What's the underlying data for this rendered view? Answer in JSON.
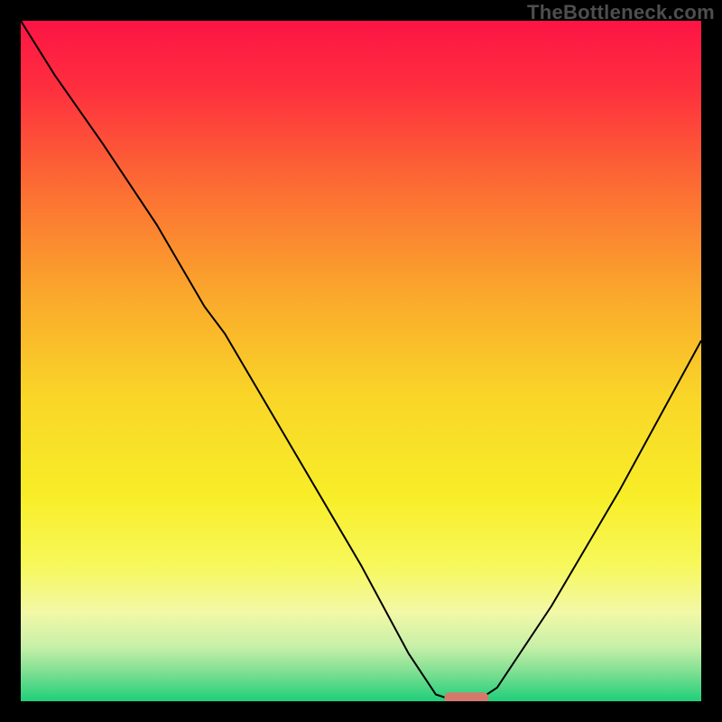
{
  "watermark": "TheBottleneck.com",
  "chart_data": {
    "type": "line",
    "title": "",
    "xlabel": "",
    "ylabel": "",
    "xlim": [
      0,
      100
    ],
    "ylim": [
      0,
      100
    ],
    "legend": false,
    "grid": false,
    "background": {
      "type": "vertical-gradient",
      "description": "Smooth vertical gradient from red at top through orange, yellow, pale yellow, pale green to green at bottom, representing severity (top=bad, bottom=good).",
      "stops": [
        {
          "pos": 0.0,
          "color": "#fd1445"
        },
        {
          "pos": 0.1,
          "color": "#fe2f3e"
        },
        {
          "pos": 0.25,
          "color": "#fc6f33"
        },
        {
          "pos": 0.4,
          "color": "#faa72c"
        },
        {
          "pos": 0.55,
          "color": "#f9d528"
        },
        {
          "pos": 0.7,
          "color": "#f8ee28"
        },
        {
          "pos": 0.8,
          "color": "#f7f85b"
        },
        {
          "pos": 0.87,
          "color": "#f2f8a7"
        },
        {
          "pos": 0.92,
          "color": "#c7f0a8"
        },
        {
          "pos": 0.96,
          "color": "#79de91"
        },
        {
          "pos": 1.0,
          "color": "#1ecf7a"
        }
      ]
    },
    "series": [
      {
        "name": "bottleneck-curve",
        "color": "#000000",
        "stroke_width": 2,
        "x": [
          0,
          5,
          12,
          20,
          27,
          30,
          40,
          50,
          57,
          61,
          64,
          67,
          70,
          78,
          88,
          100
        ],
        "y": [
          100,
          92,
          82,
          70,
          58,
          54,
          37,
          20,
          7,
          1,
          0,
          0,
          2,
          14,
          31,
          53
        ]
      }
    ],
    "markers": [
      {
        "name": "optimal-marker",
        "shape": "rounded-bar",
        "color": "#d6796d",
        "x": 65.5,
        "y": 0.5,
        "width_pct": 6.5,
        "height_pct": 1.6
      }
    ]
  }
}
